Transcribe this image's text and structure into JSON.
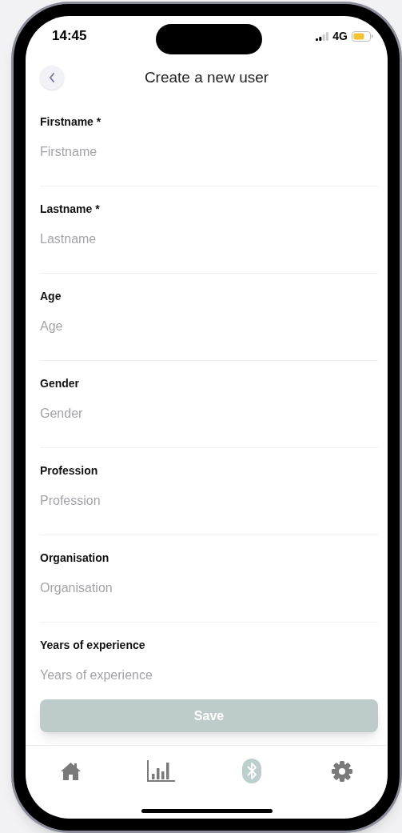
{
  "status_bar": {
    "time": "14:45",
    "network": "4G"
  },
  "header": {
    "title": "Create a new user"
  },
  "fields": [
    {
      "label": "Firstname *",
      "placeholder": "Firstname"
    },
    {
      "label": "Lastname *",
      "placeholder": "Lastname"
    },
    {
      "label": "Age",
      "placeholder": "Age"
    },
    {
      "label": "Gender",
      "placeholder": "Gender"
    },
    {
      "label": "Profession",
      "placeholder": "Profession"
    },
    {
      "label": "Organisation",
      "placeholder": "Organisation"
    },
    {
      "label": "Years of experience",
      "placeholder": "Years of experience"
    }
  ],
  "save_button": {
    "label": "Save",
    "disabled": true
  },
  "tab_bar": [
    {
      "kind": "home",
      "selected": false
    },
    {
      "kind": "chart",
      "selected": false
    },
    {
      "kind": "bluetooth",
      "selected": true
    },
    {
      "kind": "settings",
      "selected": false
    }
  ]
}
